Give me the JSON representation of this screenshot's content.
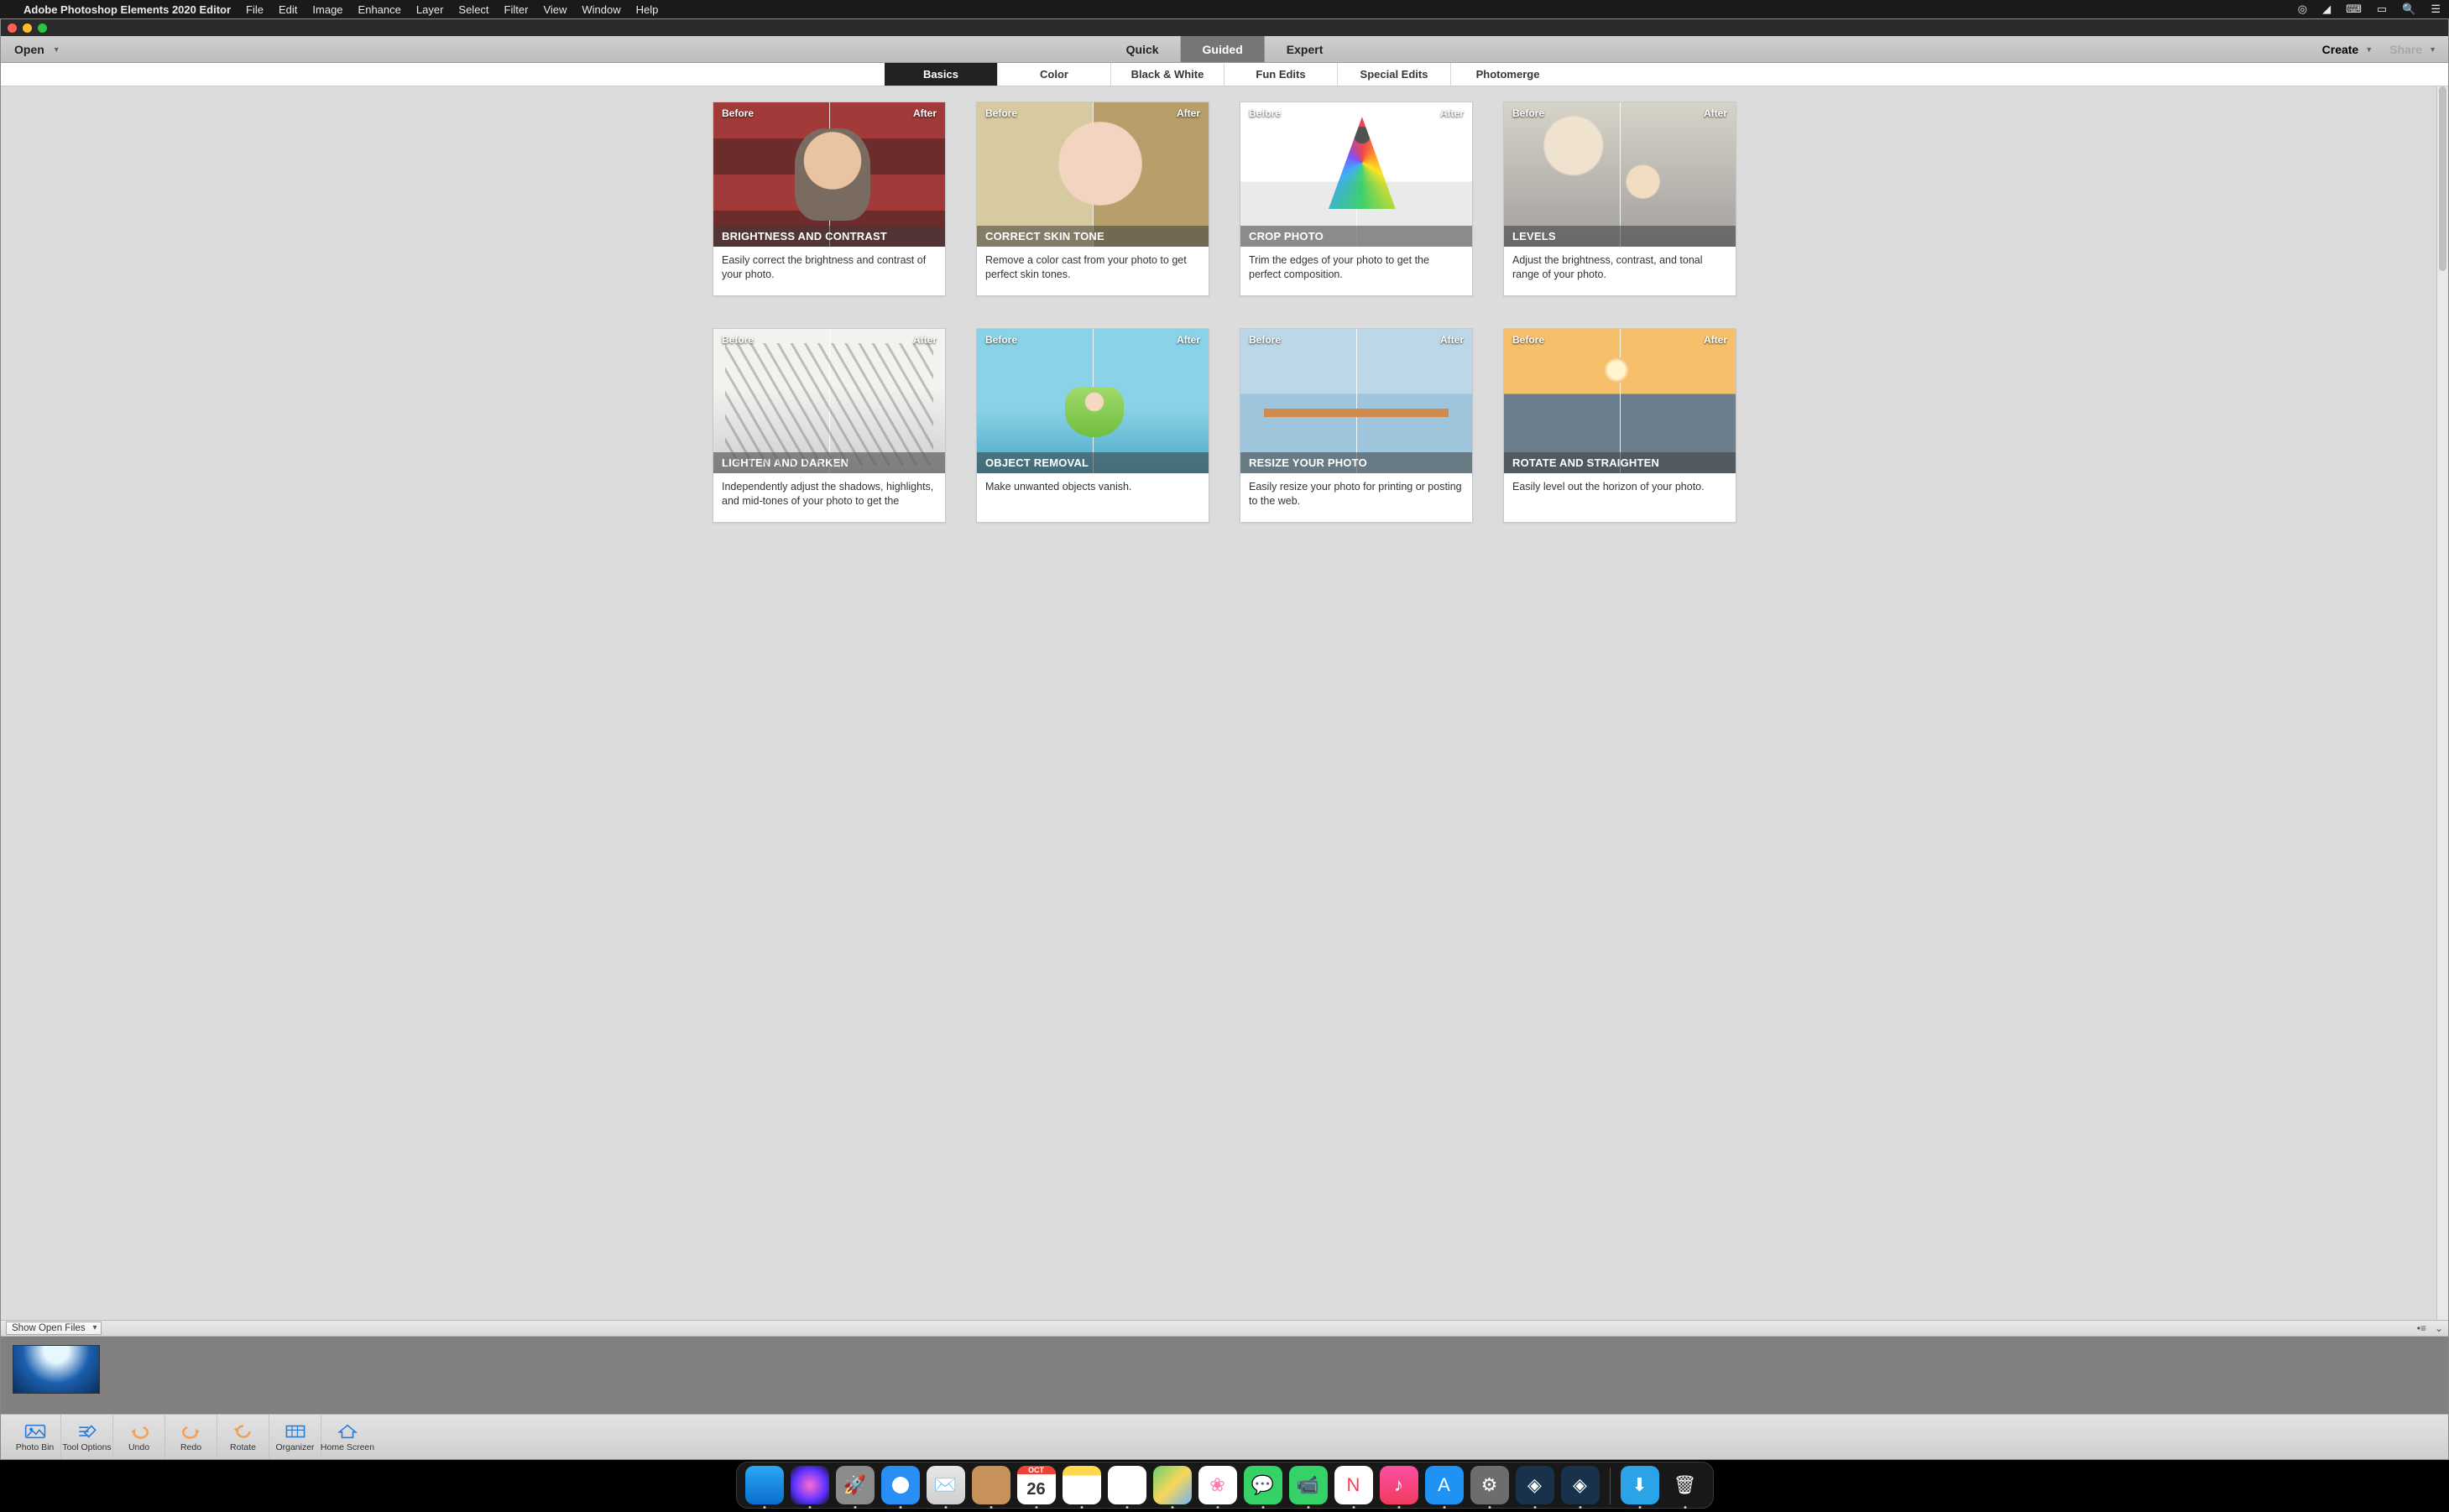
{
  "mac_menu": {
    "app_name": "Adobe Photoshop Elements 2020 Editor",
    "items": [
      "File",
      "Edit",
      "Image",
      "Enhance",
      "Layer",
      "Select",
      "Filter",
      "View",
      "Window",
      "Help"
    ]
  },
  "toolbar": {
    "open_label": "Open",
    "modes": [
      {
        "label": "Quick",
        "active": false
      },
      {
        "label": "Guided",
        "active": true
      },
      {
        "label": "Expert",
        "active": false
      }
    ],
    "create_label": "Create",
    "share_label": "Share"
  },
  "categories": [
    {
      "label": "Basics",
      "active": true
    },
    {
      "label": "Color",
      "active": false
    },
    {
      "label": "Black & White",
      "active": false
    },
    {
      "label": "Fun Edits",
      "active": false
    },
    {
      "label": "Special Edits",
      "active": false
    },
    {
      "label": "Photomerge",
      "active": false
    }
  ],
  "before_label": "Before",
  "after_label": "After",
  "cards": [
    {
      "title": "BRIGHTNESS AND CONTRAST",
      "desc": "Easily correct the brightness and contrast of your photo.",
      "thumb": "thumb-boy"
    },
    {
      "title": "CORRECT SKIN TONE",
      "desc": "Remove a color cast from your photo to get perfect skin tones.",
      "thumb": "thumb-baby"
    },
    {
      "title": "CROP PHOTO",
      "desc": "Trim the edges of your photo to get the perfect composition.",
      "thumb": "thumb-crop"
    },
    {
      "title": "LEVELS",
      "desc": "Adjust the brightness, contrast, and tonal range of your photo.",
      "thumb": "thumb-levels"
    },
    {
      "title": "LIGHTEN AND DARKEN",
      "desc": "Independently adjust the shadows, highlights, and mid-tones of your photo to get the",
      "thumb": "thumb-lighten"
    },
    {
      "title": "OBJECT REMOVAL",
      "desc": "Make unwanted objects vanish.",
      "thumb": "thumb-object"
    },
    {
      "title": "RESIZE YOUR PHOTO",
      "desc": "Easily resize your photo for printing or posting to the web.",
      "thumb": "thumb-resize"
    },
    {
      "title": "ROTATE AND STRAIGHTEN",
      "desc": "Easily level out the horizon of your photo.",
      "thumb": "thumb-rotate"
    }
  ],
  "panel_bar": {
    "select_label": "Show Open Files"
  },
  "bottom_tools": [
    {
      "label": "Photo Bin",
      "name": "photo-bin",
      "active": true
    },
    {
      "label": "Tool Options",
      "name": "tool-options",
      "active": false
    },
    {
      "label": "Undo",
      "name": "undo",
      "active": false
    },
    {
      "label": "Redo",
      "name": "redo",
      "active": false
    },
    {
      "label": "Rotate",
      "name": "rotate",
      "active": false
    },
    {
      "label": "Organizer",
      "name": "organizer",
      "active": false
    },
    {
      "label": "Home Screen",
      "name": "home-screen",
      "active": false
    }
  ],
  "dock": [
    {
      "name": "finder",
      "bg": "linear-gradient(#2aa7f4,#0a6fcf)",
      "glyph": ""
    },
    {
      "name": "siri",
      "bg": "radial-gradient(circle,#ff6bd5,#5a31ff 60%,#111)",
      "glyph": ""
    },
    {
      "name": "launchpad",
      "bg": "#8b8b8b",
      "glyph": "🚀"
    },
    {
      "name": "safari",
      "bg": "radial-gradient(circle,#fff 0 30%,#2a8ff4 31% 100%)",
      "glyph": ""
    },
    {
      "name": "mail",
      "bg": "linear-gradient(#e7e7e7,#cfcfcf)",
      "glyph": "✉️"
    },
    {
      "name": "contacts",
      "bg": "#c7925a",
      "glyph": ""
    },
    {
      "name": "calendar",
      "bg": "#fff",
      "glyph": "26"
    },
    {
      "name": "notes",
      "bg": "linear-gradient(#ffd94a 0 25%,#fff 25%)",
      "glyph": ""
    },
    {
      "name": "reminders",
      "bg": "#fff",
      "glyph": ""
    },
    {
      "name": "maps",
      "bg": "linear-gradient(135deg,#6cd06f,#f7d65a,#6fb4f2)",
      "glyph": ""
    },
    {
      "name": "photos",
      "bg": "#fff",
      "glyph": "❀"
    },
    {
      "name": "messages",
      "bg": "#35d267",
      "glyph": "💬"
    },
    {
      "name": "facetime",
      "bg": "#35d267",
      "glyph": "📹"
    },
    {
      "name": "news",
      "bg": "#fff",
      "glyph": "N"
    },
    {
      "name": "music",
      "bg": "linear-gradient(#fb4ea3,#f23b5e)",
      "glyph": "♪"
    },
    {
      "name": "appstore",
      "bg": "#1f93f5",
      "glyph": "A"
    },
    {
      "name": "settings",
      "bg": "#6d6d6d",
      "glyph": "⚙"
    },
    {
      "name": "pse-organizer",
      "bg": "#17324a",
      "glyph": "◈"
    },
    {
      "name": "pse-editor",
      "bg": "#17324a",
      "glyph": "◈"
    }
  ],
  "dock_right": [
    {
      "name": "downloads",
      "bg": "#2aa3e8",
      "glyph": "⬇"
    },
    {
      "name": "trash",
      "bg": "transparent",
      "glyph": "🗑"
    }
  ],
  "calendar_month": "OCT"
}
